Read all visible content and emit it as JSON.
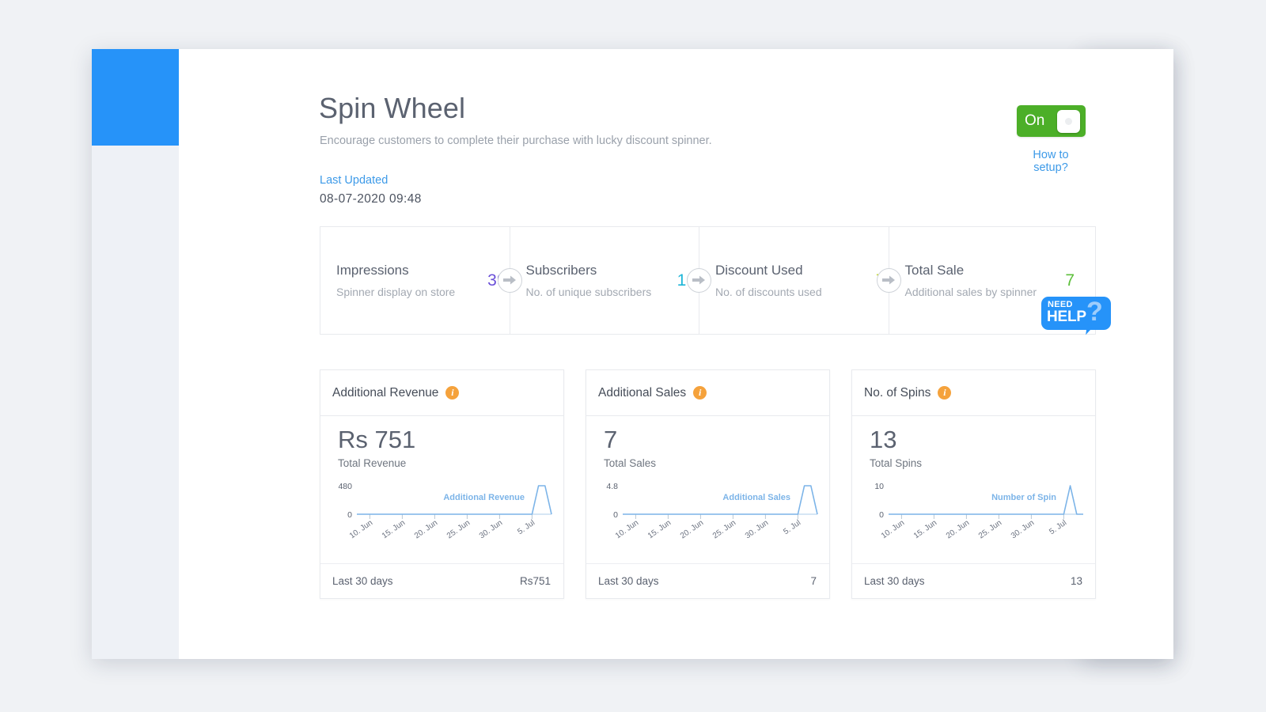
{
  "header": {
    "title": "Spin Wheel",
    "subtitle": "Encourage customers to complete their purchase with lucky discount spinner.",
    "last_updated_label": "Last Updated",
    "last_updated_value": "08-07-2020   09:48",
    "toggle_label": "On",
    "toggle_state": "on",
    "how_to_setup": "How to setup?",
    "toggle_color": "#4caf28",
    "link_color": "#3d9ae8"
  },
  "stats": [
    {
      "title": "Impressions",
      "desc": "Spinner display on store",
      "value": "39",
      "color": "#6a4fd8"
    },
    {
      "title": "Subscribers",
      "desc": "No. of unique subscribers",
      "value": "10",
      "color": "#1fb6d8"
    },
    {
      "title": "Discount Used",
      "desc": "No. of discounts used",
      "value": "7",
      "color": "#c3d82e"
    },
    {
      "title": "Total Sale",
      "desc": "Additional sales by spinner",
      "value": "7",
      "color": "#5cbf3b"
    }
  ],
  "cards": [
    {
      "title": "Additional Revenue",
      "info_icon": "info-icon",
      "big_value": "Rs 751",
      "caption": "Total Revenue",
      "foot_left": "Last 30 days",
      "foot_right": "Rs751"
    },
    {
      "title": "Additional Sales",
      "info_icon": "info-icon",
      "big_value": "7",
      "caption": "Total Sales",
      "foot_left": "Last 30 days",
      "foot_right": "7"
    },
    {
      "title": "No. of Spins",
      "info_icon": "info-icon",
      "big_value": "13",
      "caption": "Total Spins",
      "foot_left": "Last 30 days",
      "foot_right": "13"
    }
  ],
  "chart_data": [
    {
      "type": "line",
      "title": "Additional Revenue",
      "series_label": "Additional Revenue",
      "ylabel": "",
      "xlabel": "",
      "ymax_tick": "480",
      "ymin_tick": "0",
      "ylim": [
        0,
        480
      ],
      "grid": false,
      "legend": "inline-right",
      "line_color": "#7cb4e8",
      "tick_labels": [
        "10. Jun",
        "15. Jun",
        "20. Jun",
        "25. Jun",
        "30. Jun",
        "5. Jul"
      ],
      "x": [
        "8. Jun",
        "9. Jun",
        "10. Jun",
        "11. Jun",
        "12. Jun",
        "13. Jun",
        "14. Jun",
        "15. Jun",
        "16. Jun",
        "17. Jun",
        "18. Jun",
        "19. Jun",
        "20. Jun",
        "21. Jun",
        "22. Jun",
        "23. Jun",
        "24. Jun",
        "25. Jun",
        "26. Jun",
        "27. Jun",
        "28. Jun",
        "29. Jun",
        "30. Jun",
        "1. Jul",
        "2. Jul",
        "3. Jul",
        "4. Jul",
        "5. Jul",
        "6. Jul",
        "7. Jul",
        "8. Jul"
      ],
      "values": [
        0,
        0,
        0,
        0,
        0,
        0,
        0,
        0,
        0,
        0,
        0,
        0,
        0,
        0,
        0,
        0,
        0,
        0,
        0,
        0,
        0,
        0,
        0,
        0,
        0,
        0,
        0,
        0,
        480,
        480,
        0
      ]
    },
    {
      "type": "line",
      "title": "Additional Sales",
      "series_label": "Additional Sales",
      "ylabel": "",
      "xlabel": "",
      "ymax_tick": "4.8",
      "ymin_tick": "0",
      "ylim": [
        0,
        4.8
      ],
      "grid": false,
      "legend": "inline-right",
      "line_color": "#7cb4e8",
      "tick_labels": [
        "10. Jun",
        "15. Jun",
        "20. Jun",
        "25. Jun",
        "30. Jun",
        "5. Jul"
      ],
      "x": [
        "8. Jun",
        "9. Jun",
        "10. Jun",
        "11. Jun",
        "12. Jun",
        "13. Jun",
        "14. Jun",
        "15. Jun",
        "16. Jun",
        "17. Jun",
        "18. Jun",
        "19. Jun",
        "20. Jun",
        "21. Jun",
        "22. Jun",
        "23. Jun",
        "24. Jun",
        "25. Jun",
        "26. Jun",
        "27. Jun",
        "28. Jun",
        "29. Jun",
        "30. Jun",
        "1. Jul",
        "2. Jul",
        "3. Jul",
        "4. Jul",
        "5. Jul",
        "6. Jul",
        "7. Jul",
        "8. Jul"
      ],
      "values": [
        0,
        0,
        0,
        0,
        0,
        0,
        0,
        0,
        0,
        0,
        0,
        0,
        0,
        0,
        0,
        0,
        0,
        0,
        0,
        0,
        0,
        0,
        0,
        0,
        0,
        0,
        0,
        0,
        4.8,
        4.8,
        0
      ]
    },
    {
      "type": "line",
      "title": "No. of Spins",
      "series_label": "Number of Spin",
      "ylabel": "",
      "xlabel": "",
      "ymax_tick": "10",
      "ymin_tick": "0",
      "ylim": [
        0,
        10
      ],
      "grid": false,
      "legend": "inline-right",
      "line_color": "#7cb4e8",
      "tick_labels": [
        "10. Jun",
        "15. Jun",
        "20. Jun",
        "25. Jun",
        "30. Jun",
        "5. Jul"
      ],
      "x": [
        "8. Jun",
        "9. Jun",
        "10. Jun",
        "11. Jun",
        "12. Jun",
        "13. Jun",
        "14. Jun",
        "15. Jun",
        "16. Jun",
        "17. Jun",
        "18. Jun",
        "19. Jun",
        "20. Jun",
        "21. Jun",
        "22. Jun",
        "23. Jun",
        "24. Jun",
        "25. Jun",
        "26. Jun",
        "27. Jun",
        "28. Jun",
        "29. Jun",
        "30. Jun",
        "1. Jul",
        "2. Jul",
        "3. Jul",
        "4. Jul",
        "5. Jul",
        "6. Jul",
        "7. Jul",
        "8. Jul"
      ],
      "values": [
        0,
        0,
        0,
        0,
        0,
        0,
        0,
        0,
        0,
        0,
        0,
        0,
        0,
        0,
        0,
        0,
        0,
        0,
        0,
        0,
        0,
        0,
        0,
        0,
        0,
        0,
        0,
        0,
        10,
        0,
        0
      ]
    }
  ],
  "need_help": {
    "line1": "NEED",
    "line2": "HELP",
    "mark": "?",
    "color": "#2693f9"
  }
}
